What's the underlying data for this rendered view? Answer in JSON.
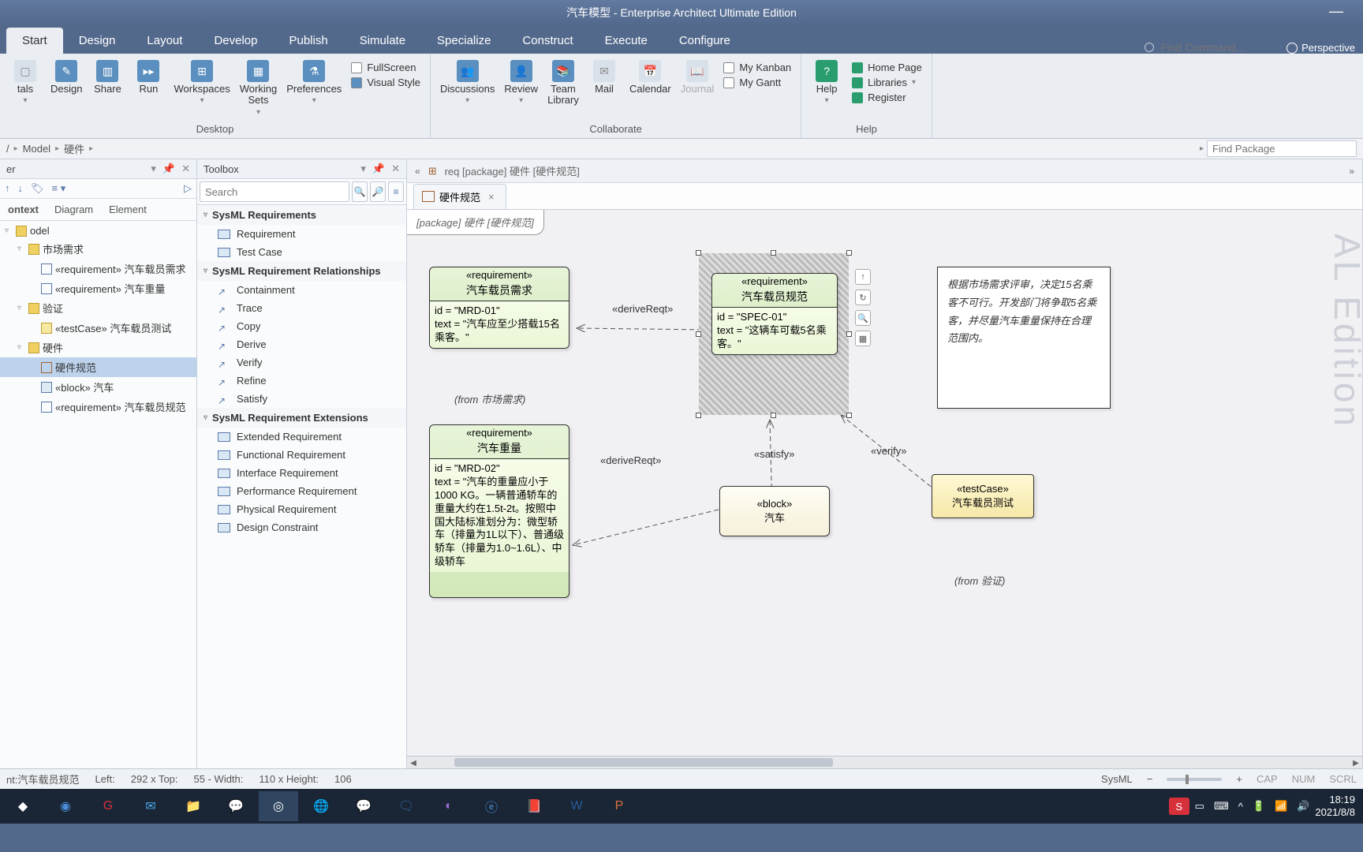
{
  "app": {
    "title": "汽车模型 - Enterprise Architect Ultimate Edition"
  },
  "ribbon": {
    "tabs": [
      "Start",
      "Design",
      "Layout",
      "Develop",
      "Publish",
      "Simulate",
      "Specialize",
      "Construct",
      "Execute",
      "Configure"
    ],
    "find_cmd_ph": "Find Command...",
    "perspective": "Perspective",
    "groups": {
      "desktop": {
        "label": "Desktop",
        "items": {
          "portals": "tals",
          "design": "Design",
          "share": "Share",
          "run": "Run",
          "workspaces": "Workspaces",
          "working_sets": "Working\nSets",
          "preferences": "Preferences",
          "fullscreen": "FullScreen",
          "visual_style": "Visual Style"
        }
      },
      "collaborate": {
        "label": "Collaborate",
        "items": {
          "discussions": "Discussions",
          "review": "Review",
          "team_library": "Team\nLibrary",
          "mail": "Mail",
          "calendar": "Calendar",
          "journal": "Journal",
          "my_kanban": "My Kanban",
          "my_gantt": "My Gantt"
        }
      },
      "help": {
        "label": "Help",
        "items": {
          "help": "Help",
          "home_page": "Home Page",
          "libraries": "Libraries",
          "register": "Register"
        }
      }
    }
  },
  "breadcrumb": {
    "segments": [
      "Model",
      "硬件"
    ],
    "find_pkg_ph": "Find Package"
  },
  "browser": {
    "title": "er",
    "tabs": [
      "ontext",
      "Diagram",
      "Element"
    ],
    "tree": [
      {
        "lvl": 0,
        "tw": "▿",
        "ico": "pkg",
        "label": "odel"
      },
      {
        "lvl": 1,
        "tw": "▿",
        "ico": "pkg",
        "label": "市场需求"
      },
      {
        "lvl": 2,
        "tw": "",
        "ico": "req",
        "label": "«requirement» 汽车载员需求"
      },
      {
        "lvl": 2,
        "tw": "",
        "ico": "req",
        "label": "«requirement» 汽车重量"
      },
      {
        "lvl": 1,
        "tw": "▿",
        "ico": "pkg",
        "label": "验证"
      },
      {
        "lvl": 2,
        "tw": "",
        "ico": "tc",
        "label": "«testCase» 汽车载员测试"
      },
      {
        "lvl": 1,
        "tw": "▿",
        "ico": "pkg",
        "label": "硬件"
      },
      {
        "lvl": 2,
        "tw": "",
        "ico": "diag",
        "label": "硬件规范",
        "sel": true
      },
      {
        "lvl": 2,
        "tw": "",
        "ico": "blk",
        "label": "«block» 汽车"
      },
      {
        "lvl": 2,
        "tw": "",
        "ico": "req",
        "label": "«requirement» 汽车载员规范"
      }
    ]
  },
  "toolbox": {
    "title": "Toolbox",
    "search_ph": "Search",
    "sections": [
      {
        "h": "SysML Requirements",
        "items": [
          {
            "ico": "box",
            "l": "Requirement"
          },
          {
            "ico": "box",
            "l": "Test Case"
          }
        ]
      },
      {
        "h": "SysML Requirement Relationships",
        "items": [
          {
            "ico": "arr",
            "l": "Containment"
          },
          {
            "ico": "arr",
            "l": "Trace"
          },
          {
            "ico": "arr",
            "l": "Copy"
          },
          {
            "ico": "arr",
            "l": "Derive"
          },
          {
            "ico": "arr",
            "l": "Verify"
          },
          {
            "ico": "arr",
            "l": "Refine"
          },
          {
            "ico": "arr",
            "l": "Satisfy"
          }
        ]
      },
      {
        "h": "SysML Requirement Extensions",
        "items": [
          {
            "ico": "box",
            "l": "Extended Requirement"
          },
          {
            "ico": "box",
            "l": "Functional Requirement"
          },
          {
            "ico": "box",
            "l": "Interface Requirement"
          },
          {
            "ico": "box",
            "l": "Performance Requirement"
          },
          {
            "ico": "box",
            "l": "Physical Requirement"
          },
          {
            "ico": "box",
            "l": "Design Constraint"
          }
        ]
      }
    ]
  },
  "canvas": {
    "breadcrumb": "req [package] 硬件 [硬件规范]",
    "tab_title": "硬件规范",
    "frame": "[package] 硬件 [硬件规范]",
    "req1": {
      "stereo": "«requirement»",
      "name": "汽车载员需求",
      "id": "id = \"MRD-01\"",
      "text": "text = \"汽车应至少搭载15名乘客。\"",
      "from": "(from 市场需求)"
    },
    "req2": {
      "stereo": "«requirement»",
      "name": "汽车载员规范",
      "id": "id = \"SPEC-01\"",
      "text": "text = \"这辆车可载5名乘客。\""
    },
    "req3": {
      "stereo": "«requirement»",
      "name": "汽车重量",
      "id": "id = \"MRD-02\"",
      "text": "text = \"汽车的重量应小于1000 KG。一辆普通轿车的重量大约在1.5t-2t。按照中国大陆标准划分为：微型轿车（排量为1L以下）、普通级轿车（排量为1.0~1.6L）、中级轿车"
    },
    "block": {
      "stereo": "«block»",
      "name": "汽车"
    },
    "tc": {
      "stereo": "«testCase»",
      "name": "汽车载员测试",
      "from": "(from 验证)"
    },
    "note": "根据市场需求评审，决定15名乘客不可行。开发部门将争取5名乘客，并尽量汽车重量保持在合理范围内。",
    "rel": {
      "derive1": "«deriveReqt»",
      "derive2": "«deriveReqt»",
      "satisfy": "«satisfy»",
      "verify": "«verify»"
    }
  },
  "status": {
    "element": "nt:汽车载员规范",
    "left": "Left:",
    "left_v": "292 x Top:",
    "top_v": "55 - Width:",
    "width_v": "110 x Height:",
    "height_v": "106",
    "lang": "SysML",
    "caps": "CAP",
    "num": "NUM",
    "scrl": "SCRL"
  },
  "taskbar": {
    "time": "18:19",
    "date": "2021/8/8",
    "ime": "S"
  },
  "watermark": "AL Edition"
}
